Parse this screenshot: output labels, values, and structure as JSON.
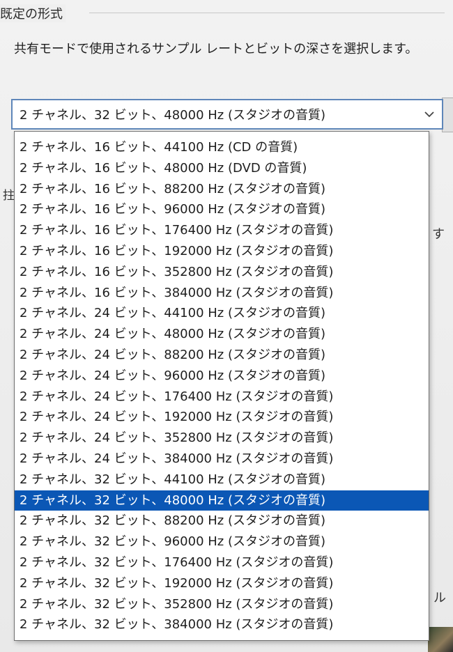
{
  "group": {
    "title": "既定の形式"
  },
  "description": "共有モードで使用されるサンプル レートとビットの深さを選択します。",
  "fragments": {
    "left": "拄",
    "right_top": "す",
    "right_bottom": "ル"
  },
  "format_combo": {
    "value": "2 チャネル、32 ビット、48000 Hz (スタジオの音質)",
    "arrow_icon": "chevron-down-icon"
  },
  "format_list": {
    "selected_index": 16,
    "items": [
      "2 チャネル、16 ビット、44100 Hz (CD の音質)",
      "2 チャネル、16 ビット、48000 Hz (DVD の音質)",
      "2 チャネル、16 ビット、88200 Hz (スタジオの音質)",
      "2 チャネル、16 ビット、96000 Hz (スタジオの音質)",
      "2 チャネル、16 ビット、176400 Hz (スタジオの音質)",
      "2 チャネル、16 ビット、192000 Hz (スタジオの音質)",
      "2 チャネル、16 ビット、352800 Hz (スタジオの音質)",
      "2 チャネル、16 ビット、384000 Hz (スタジオの音質)",
      "2 チャネル、24 ビット、44100 Hz (スタジオの音質)",
      "2 チャネル、24 ビット、48000 Hz (スタジオの音質)",
      "2 チャネル、24 ビット、88200 Hz (スタジオの音質)",
      "2 チャネル、24 ビット、96000 Hz (スタジオの音質)",
      "2 チャネル、24 ビット、176400 Hz (スタジオの音質)",
      "2 チャネル、24 ビット、192000 Hz (スタジオの音質)",
      "2 チャネル、24 ビット、352800 Hz (スタジオの音質)",
      "2 チャネル、24 ビット、384000 Hz (スタジオの音質)",
      "2 チャネル、32 ビット、44100 Hz (スタジオの音質)",
      "2 チャネル、32 ビット、48000 Hz (スタジオの音質)",
      "2 チャネル、32 ビット、88200 Hz (スタジオの音質)",
      "2 チャネル、32 ビット、96000 Hz (スタジオの音質)",
      "2 チャネル、32 ビット、176400 Hz (スタジオの音質)",
      "2 チャネル、32 ビット、192000 Hz (スタジオの音質)",
      "2 チャネル、32 ビット、352800 Hz (スタジオの音質)",
      "2 チャネル、32 ビット、384000 Hz (スタジオの音質)"
    ]
  },
  "colors": {
    "selection": "#0b57b5",
    "combo_border": "#5e86b9"
  }
}
